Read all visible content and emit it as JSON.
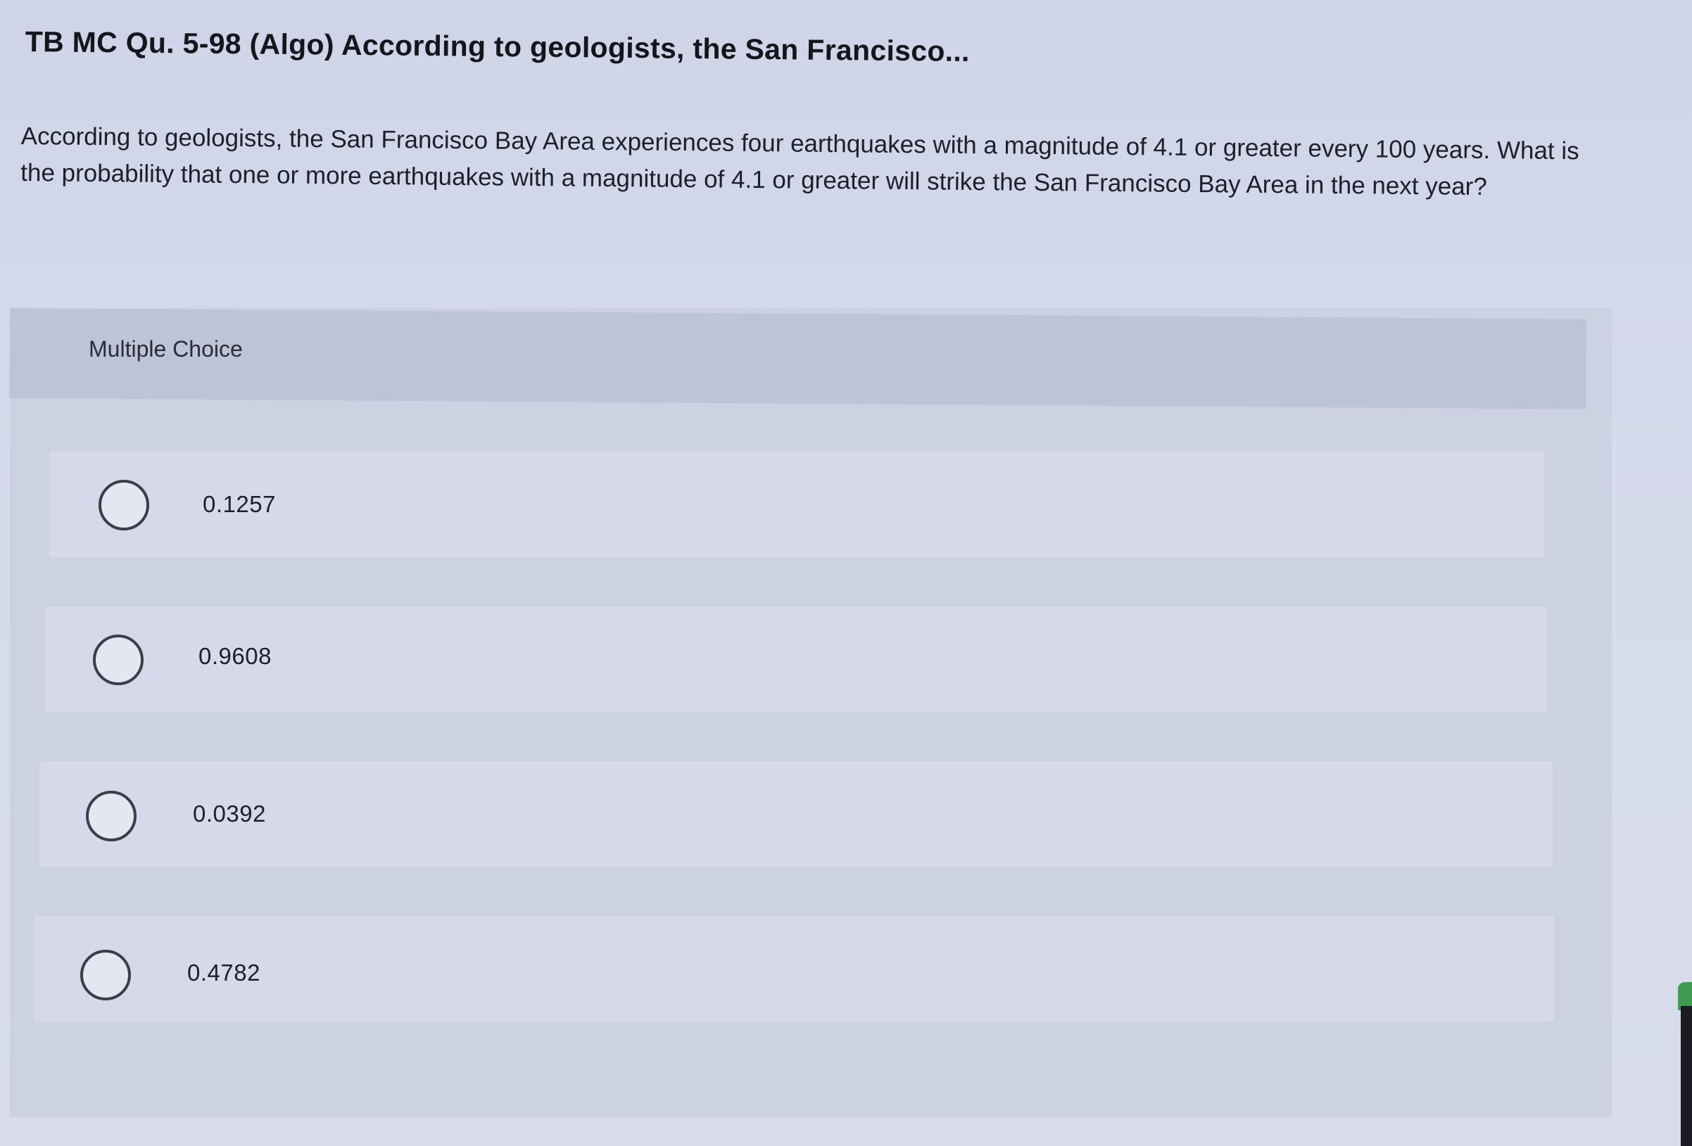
{
  "question": {
    "title": "TB MC Qu. 5-98 (Algo) According to geologists, the San Francisco...",
    "text": "According to geologists, the San Francisco Bay Area experiences four earthquakes with a magnitude of 4.1 or greater every 100 years. What is the probability that one or more earthquakes with a magnitude of 4.1 or greater will strike the San Francisco Bay Area in the next year?"
  },
  "multiple_choice": {
    "header": "Multiple Choice",
    "options": [
      {
        "label": "0.1257"
      },
      {
        "label": "0.9608"
      },
      {
        "label": "0.0392"
      },
      {
        "label": "0.4782"
      }
    ]
  },
  "colors": {
    "background": "#d3d8e8",
    "header_bar": "#bec4d7",
    "option_bg": "#d5d9ea",
    "radio_border": "#3b3d48",
    "accent_green": "#3e9b4f"
  },
  "icons": {
    "radio": "radio-button-icon"
  }
}
